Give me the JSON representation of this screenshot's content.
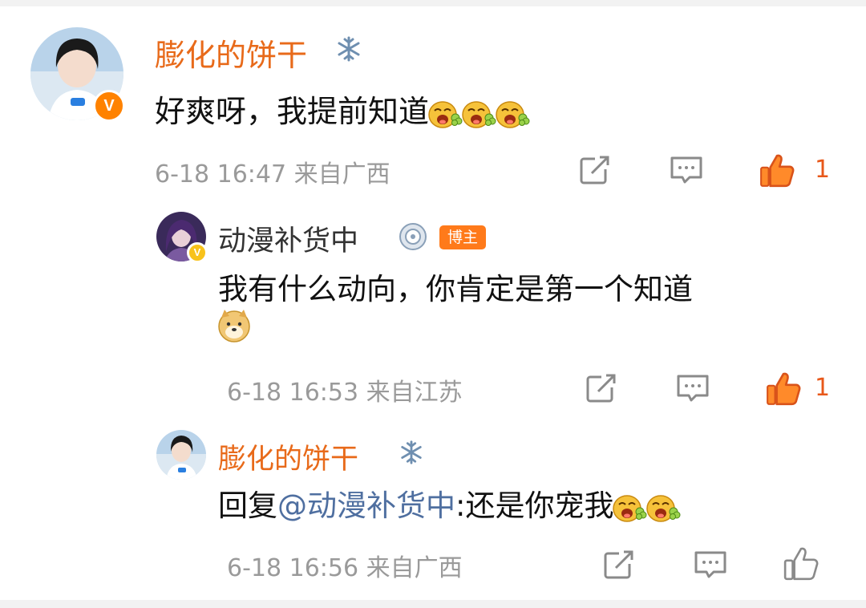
{
  "comments": [
    {
      "user": "膨化的饼干",
      "text": "好爽呀，我提前知道",
      "time": "6-18 16:47 来自广西",
      "likes": "1"
    },
    {
      "user": "动漫补货中",
      "badge": "博主",
      "text": "我有什么动向，你肯定是第一个知道",
      "time": "6-18 16:53 来自江苏",
      "likes": "1"
    },
    {
      "user": "膨化的饼干",
      "reply_prefix": "回复",
      "mention": "@动漫补货中",
      "text": ":还是你宠我",
      "time": "6-18 16:56 来自广西"
    }
  ],
  "icons": {
    "verified": "v-badge-icon",
    "share": "share-icon",
    "comment": "comment-icon",
    "like": "thumbs-up-icon",
    "emoji": "laughing-emoji-icon",
    "doge": "doge-emoji-icon"
  },
  "colors": {
    "username": "#e86a1a",
    "liked": "#e8581a",
    "meta": "#9a9a9a",
    "mention": "#4f6fa0"
  }
}
